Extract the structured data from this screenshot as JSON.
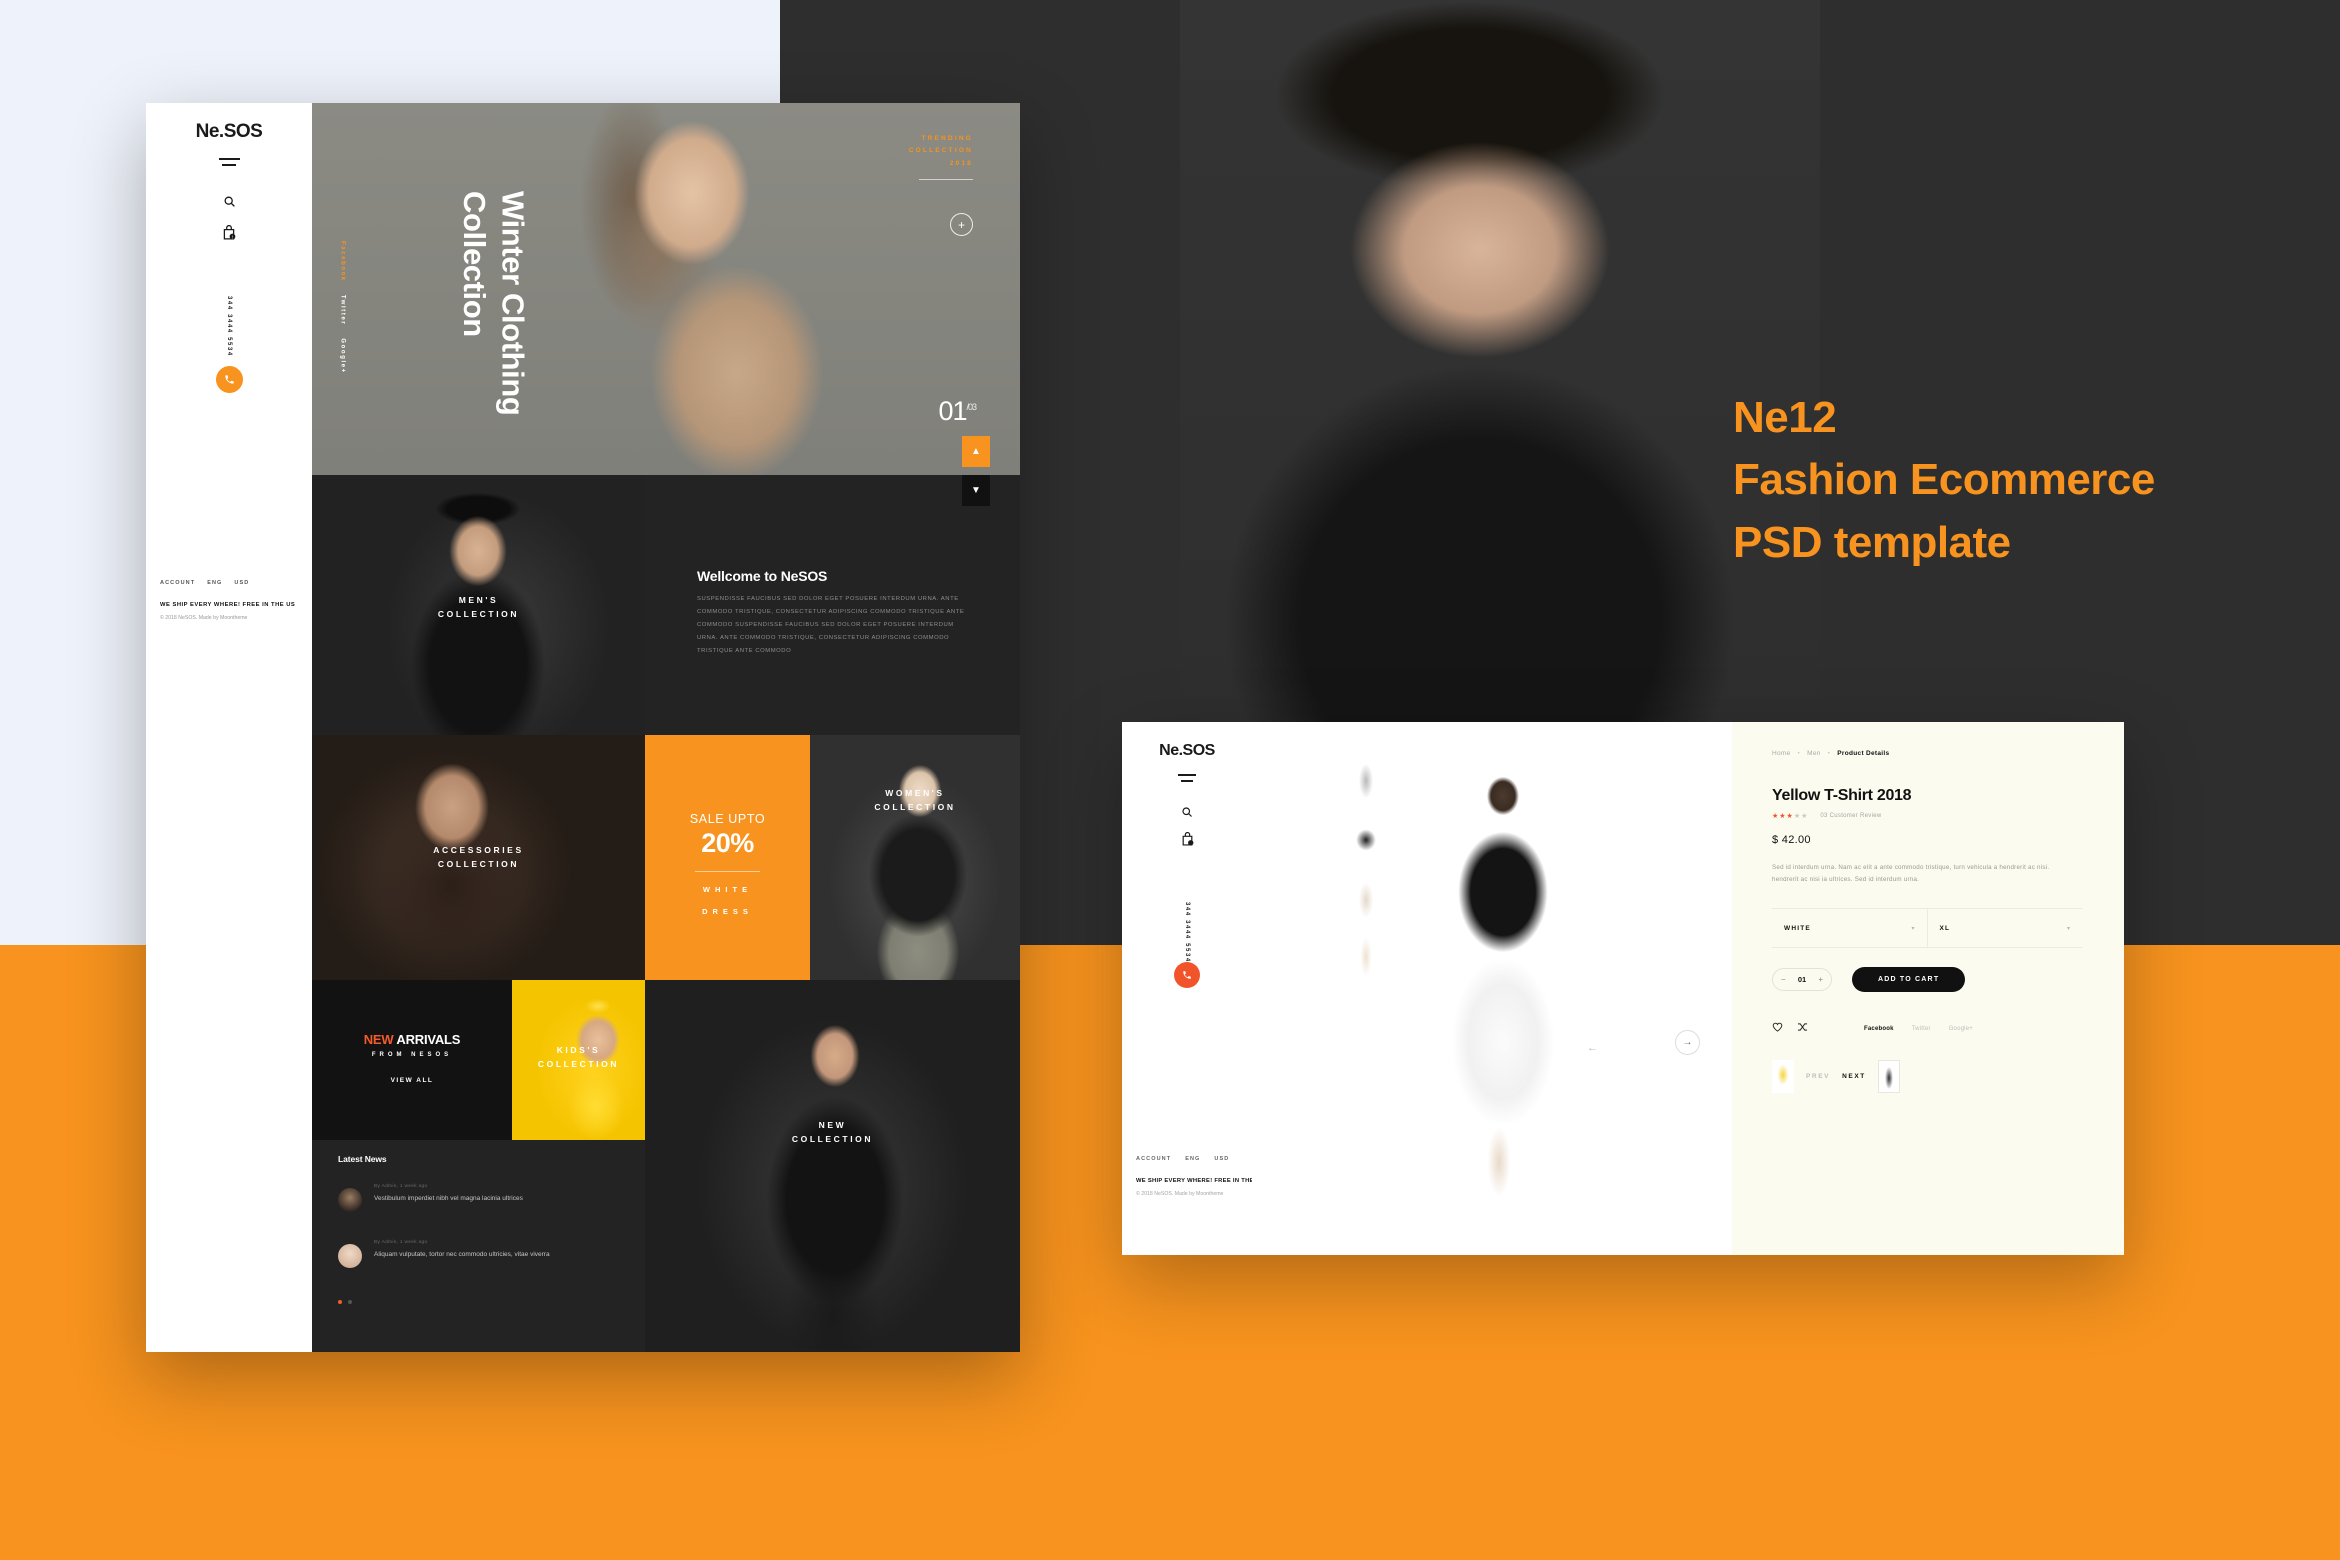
{
  "promo": {
    "headline_lines": [
      "Ne12",
      "Fashion Ecommerce",
      "PSD template"
    ],
    "accent_color": "#f7931e",
    "dark_bg": "#2e2e2e"
  },
  "home": {
    "logo": "Ne.SOS",
    "icons": {
      "menu": "hamburger-icon",
      "search": "search-icon",
      "bag": "shopping-bag-icon",
      "call": "phone-icon"
    },
    "phone": "344 3444 5534",
    "hero": {
      "eyebrow_lines": [
        "TRENDING",
        "COLLECTION",
        "2018"
      ],
      "title": "Winter Clothing Collection",
      "social": [
        "Facebook",
        "Twitter",
        "Google+"
      ],
      "plus_icon": "plus-icon",
      "slide_current": "01",
      "slide_total": "/03",
      "up_icon": "chevron-up-icon",
      "down_icon": "chevron-down-icon"
    },
    "tiles": {
      "mens": "MEN'S\nCOLLECTION",
      "womens": "WOMEN'S\nCOLLECTION",
      "accessories": "ACCESSORIES\nCOLLECTION",
      "kids": "KIDS'S\nCOLLECTION",
      "newcollection": "NEW\nCOLLECTION"
    },
    "welcome": {
      "title": "Wellcome to NeSOS",
      "body": "SUSPENDISSE FAUCIBUS SED DOLOR EGET POSUERE INTERDUM URNA. ANTE COMMODO TRISTIQUE, CONSECTETUR ADIPISCING COMMODO TRISTIQUE ANTE COMMODO SUSPENDISSE FAUCIBUS SED DOLOR EGET POSUERE INTERDUM URNA. ANTE COMMODO TRISTIQUE, CONSECTETUR ADIPISCING COMMODO TRISTIQUE ANTE COMMODO"
    },
    "sale": {
      "upto": "SALE UPTO",
      "percent": "20%",
      "line1": "WHITE",
      "line2": "DRESS"
    },
    "arrivals": {
      "title_accent": "NEW",
      "title_rest": " ARRIVALS",
      "sub": "FROM NESOS",
      "cta": "VIEW ALL"
    },
    "news": {
      "title": "Latest News",
      "items": [
        {
          "meta": "By Admin, 1 week ago",
          "text": "Vestibulum imperdiet nibh vel magna lacinia ultrices"
        },
        {
          "meta": "By Admin, 1 week ago",
          "text": "Aliquam vulputate, tortor nec commodo ultricies, vitae viverra"
        }
      ]
    },
    "footer": {
      "selectors": [
        "ACCOUNT",
        "ENG",
        "USD"
      ],
      "ship": "WE SHIP EVERY WHERE! FREE IN THE US",
      "copyright": "© 2018 NeSOS.  Made by Moontheme"
    }
  },
  "product": {
    "logo": "Ne.SOS",
    "phone": "344 3444 5534",
    "icons": {
      "menu": "hamburger-icon",
      "search": "search-icon",
      "bag": "shopping-bag-icon",
      "call": "phone-icon",
      "gallery_prev": "arrow-left-icon",
      "gallery_next": "arrow-right-icon",
      "wishlist": "heart-icon",
      "compare": "compare-icon"
    },
    "breadcrumb": {
      "home": "Home",
      "category": "Men",
      "current": "Product Details"
    },
    "name": "Yellow T-Shirt 2018",
    "stars_filled": 3,
    "stars_total": 5,
    "reviews": "03 Customer Review",
    "price": "$ 42.00",
    "description": "Sed id interdum urna. Nam ac elit a ante commodo tristique, turn vehicula a hendrerit ac nisi. hendrerit ac nisi  ia ultrices. Sed id interdum urna.",
    "options": {
      "color": "WHITE",
      "size": "XL",
      "caret": "chevron-down-icon"
    },
    "quantity": {
      "minus": "−",
      "value": "01",
      "plus": "+"
    },
    "add_to_cart": "ADD TO CART",
    "share": {
      "facebook": "Facebook",
      "twitter": "Twitter",
      "google": "Google+"
    },
    "nav": {
      "prev": "PREV",
      "next": "NEXT"
    },
    "footer": {
      "selectors": [
        "ACCOUNT",
        "ENG",
        "USD"
      ],
      "ship": "WE SHIP EVERY WHERE! FREE IN THE US",
      "copyright": "© 2018 NeSOS.  Made by Moontheme"
    }
  }
}
